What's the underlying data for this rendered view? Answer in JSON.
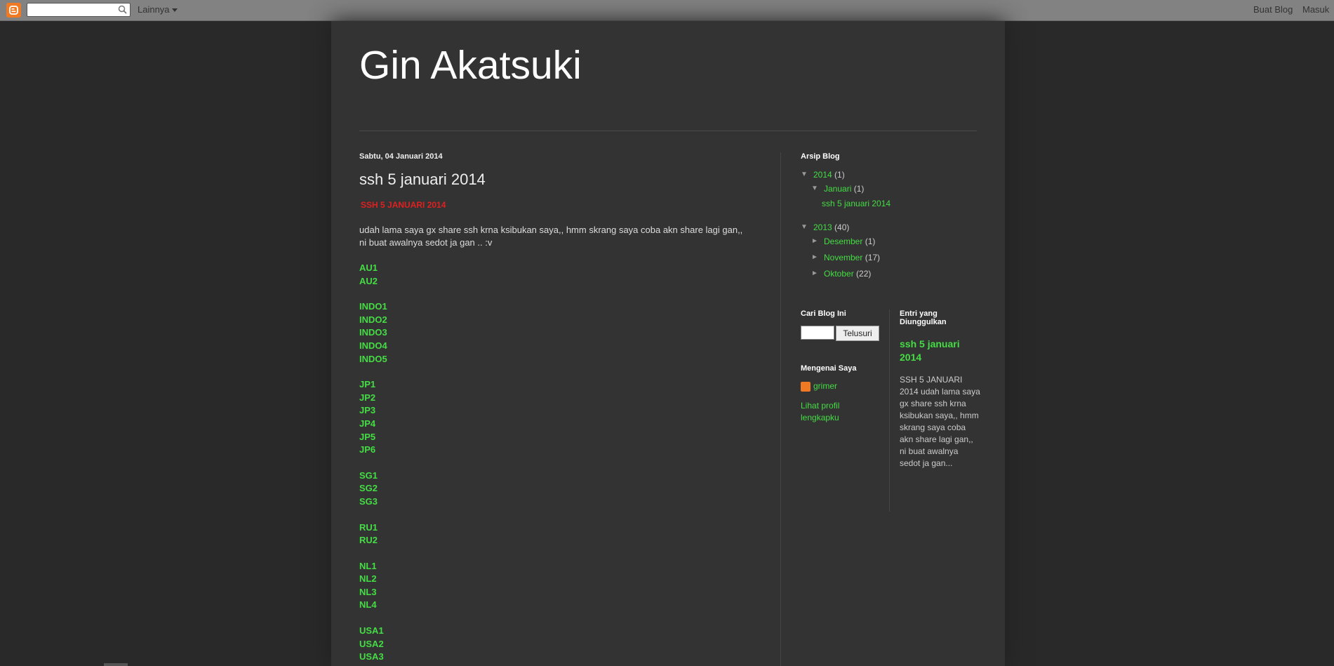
{
  "navbar": {
    "more_label": "Lainnya",
    "create_blog": "Buat Blog",
    "sign_in": "Masuk",
    "search_placeholder": ""
  },
  "blog": {
    "title": "Gin Akatsuki"
  },
  "post": {
    "date": "Sabtu, 04 Januari 2014",
    "title": "ssh 5 januari 2014",
    "subtitle": "SSH 5 JANUARI 2014",
    "body": "udah lama saya gx share ssh krna ksibukan saya,, hmm skrang saya coba akn share lagi gan,, ni buat awalnya sedot ja gan .. :v",
    "server_groups": [
      [
        "AU1",
        "AU2"
      ],
      [
        "INDO1",
        "INDO2",
        "INDO3",
        "INDO4",
        "INDO5"
      ],
      [
        "JP1",
        "JP2",
        "JP3",
        "JP4",
        "JP5",
        "JP6"
      ],
      [
        "SG1",
        "SG2",
        "SG3"
      ],
      [
        "RU1",
        "RU2"
      ],
      [
        "NL1",
        "NL2",
        "NL3",
        "NL4"
      ],
      [
        "USA1",
        "USA2",
        "USA3"
      ]
    ]
  },
  "archive": {
    "title": "Arsip Blog",
    "y2014": {
      "toggle": "▼",
      "year": "2014",
      "count": "(1)"
    },
    "jan2014": {
      "toggle": "▼",
      "month": "Januari",
      "count": "(1)"
    },
    "jan_post": "ssh 5 januari 2014",
    "y2013": {
      "toggle": "▼",
      "year": "2013",
      "count": "(40)"
    },
    "dec2013": {
      "toggle": "►",
      "month": "Desember",
      "count": "(1)"
    },
    "nov2013": {
      "toggle": "►",
      "month": "November",
      "count": "(17)"
    },
    "oct2013": {
      "toggle": "►",
      "month": "Oktober",
      "count": "(22)"
    }
  },
  "search_widget": {
    "title": "Cari Blog Ini",
    "button": "Telusuri"
  },
  "about": {
    "title": "Mengenai Saya",
    "name": "grimer",
    "profile_link": "Lihat profil lengkapku"
  },
  "popular": {
    "title": "Entri yang Diunggulkan",
    "post_title": "ssh 5 januari 2014",
    "snippet": "SSH 5 JANUARI 2014 udah lama saya gx share ssh krna ksibukan saya,, hmm skrang saya coba akn share lagi gan,, ni buat awalnya sedot ja gan..."
  },
  "colors": {
    "link": "#44dd44",
    "subtitle": "#e02020",
    "brand": "#f07a24"
  }
}
